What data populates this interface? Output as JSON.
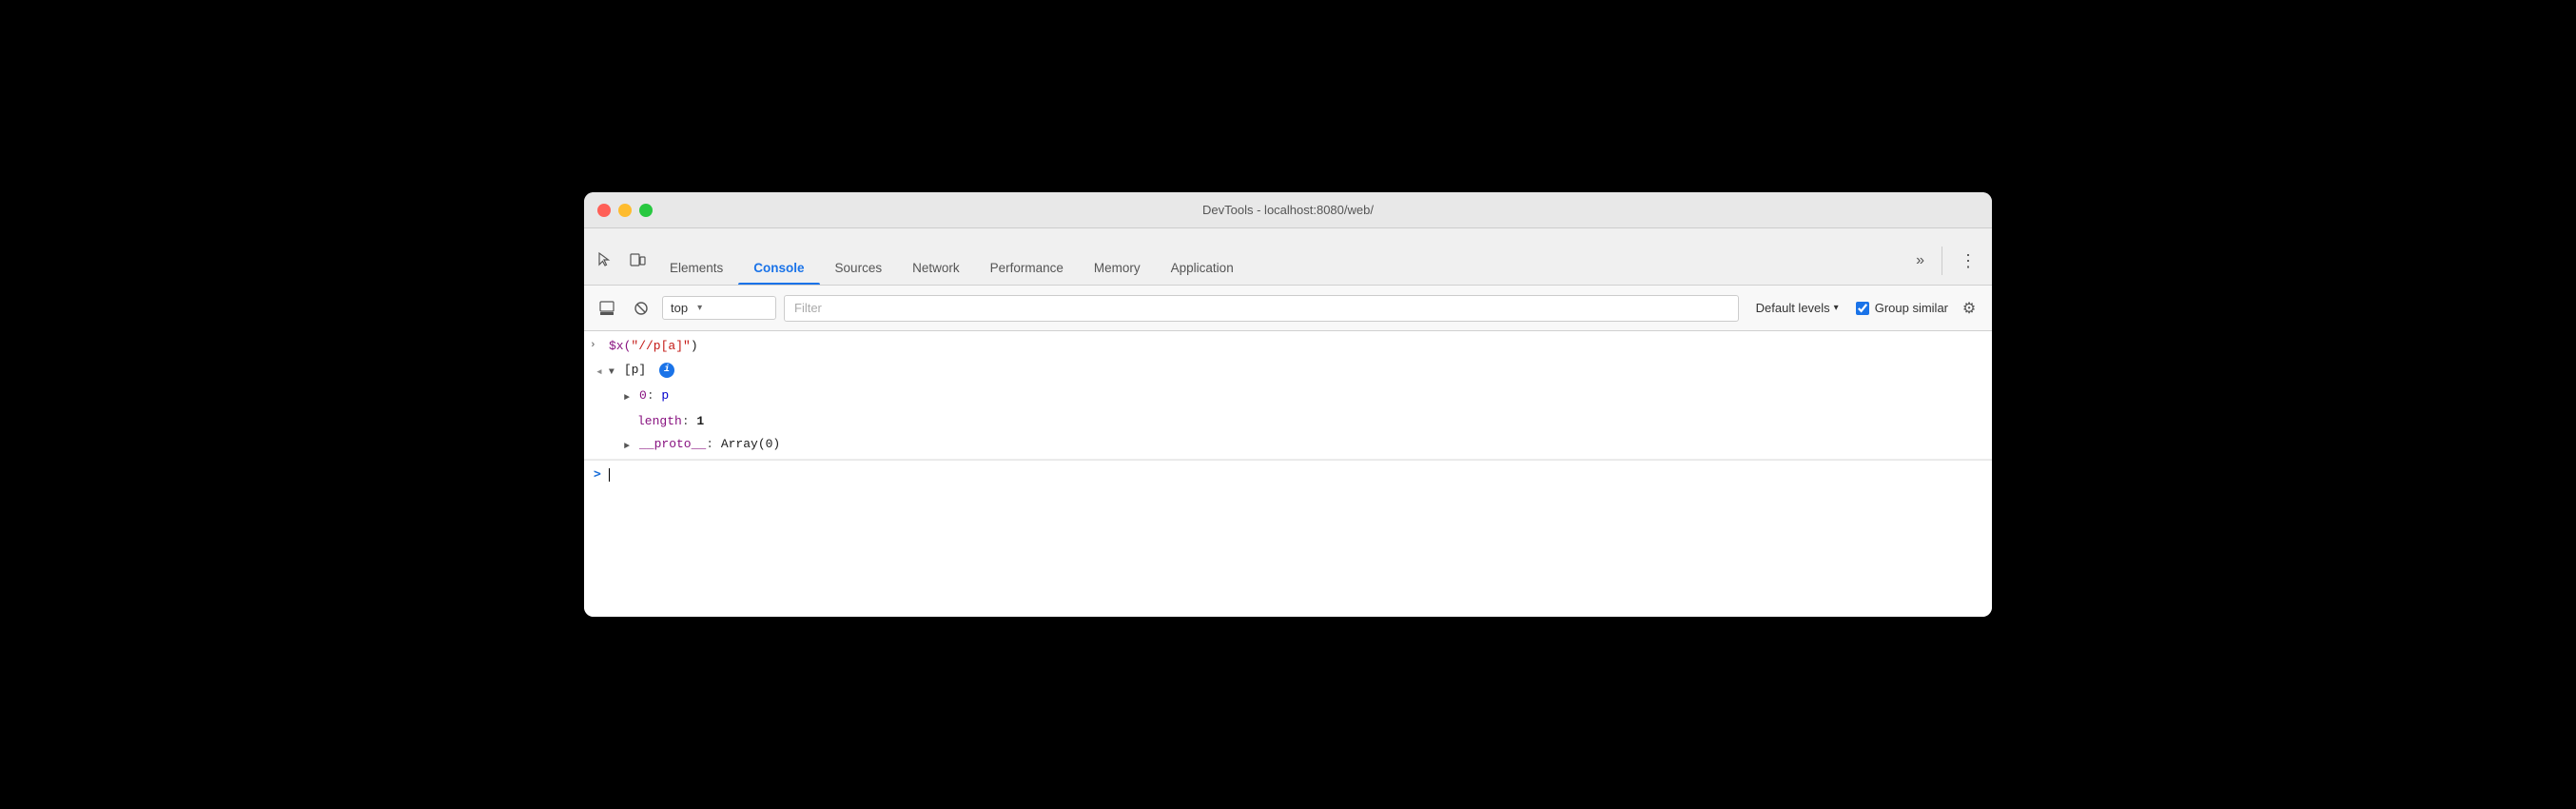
{
  "titlebar": {
    "title": "DevTools - localhost:8080/web/",
    "buttons": {
      "close": "close",
      "minimize": "minimize",
      "maximize": "maximize"
    }
  },
  "tabs": {
    "left_icons": [
      "inspect-element-icon",
      "device-toolbar-icon"
    ],
    "items": [
      {
        "id": "elements",
        "label": "Elements",
        "active": false
      },
      {
        "id": "console",
        "label": "Console",
        "active": true
      },
      {
        "id": "sources",
        "label": "Sources",
        "active": false
      },
      {
        "id": "network",
        "label": "Network",
        "active": false
      },
      {
        "id": "performance",
        "label": "Performance",
        "active": false
      },
      {
        "id": "memory",
        "label": "Memory",
        "active": false
      },
      {
        "id": "application",
        "label": "Application",
        "active": false
      }
    ],
    "more_label": "»",
    "settings_label": "⋮"
  },
  "console_toolbar": {
    "clear_label": "clear-console-icon",
    "block_label": "block-icon",
    "context": {
      "value": "top",
      "placeholder": "top"
    },
    "filter": {
      "placeholder": "Filter"
    },
    "levels": {
      "label": "Default levels",
      "arrow": "▾"
    },
    "group_similar": {
      "label": "Group similar",
      "checked": true
    },
    "settings_icon": "⚙"
  },
  "console_output": {
    "lines": [
      {
        "type": "input",
        "arrow": "›",
        "content_parts": [
          {
            "text": "$x(",
            "class": "code-purple"
          },
          {
            "text": "\"//p[a]\"",
            "class": "code-string"
          },
          {
            "text": ")",
            "class": "code-black"
          }
        ]
      },
      {
        "type": "result-header",
        "back_arrow": "‹",
        "expand_arrow": "▼",
        "label": "[p]",
        "has_badge": true,
        "badge_label": "i"
      },
      {
        "type": "result-item",
        "expand_arrow": "►",
        "indent": 2,
        "key": "0",
        "value": "p",
        "key_class": "code-purple",
        "value_class": "code-blue"
      },
      {
        "type": "result-property",
        "indent": 2,
        "key": "length",
        "key_class": "code-purple",
        "value": "1",
        "value_class": "code-black"
      },
      {
        "type": "result-item",
        "expand_arrow": "►",
        "indent": 2,
        "key": "__proto__",
        "key_class": "code-purple",
        "value": "Array(0)",
        "value_class": "code-black"
      }
    ],
    "input_prompt": ">",
    "cursor": "|"
  },
  "colors": {
    "tab_active": "#1a73e8",
    "accent_blue": "#1a73e8",
    "code_purple": "#881280",
    "code_string": "#c41a16",
    "code_blue": "#0000cc"
  }
}
